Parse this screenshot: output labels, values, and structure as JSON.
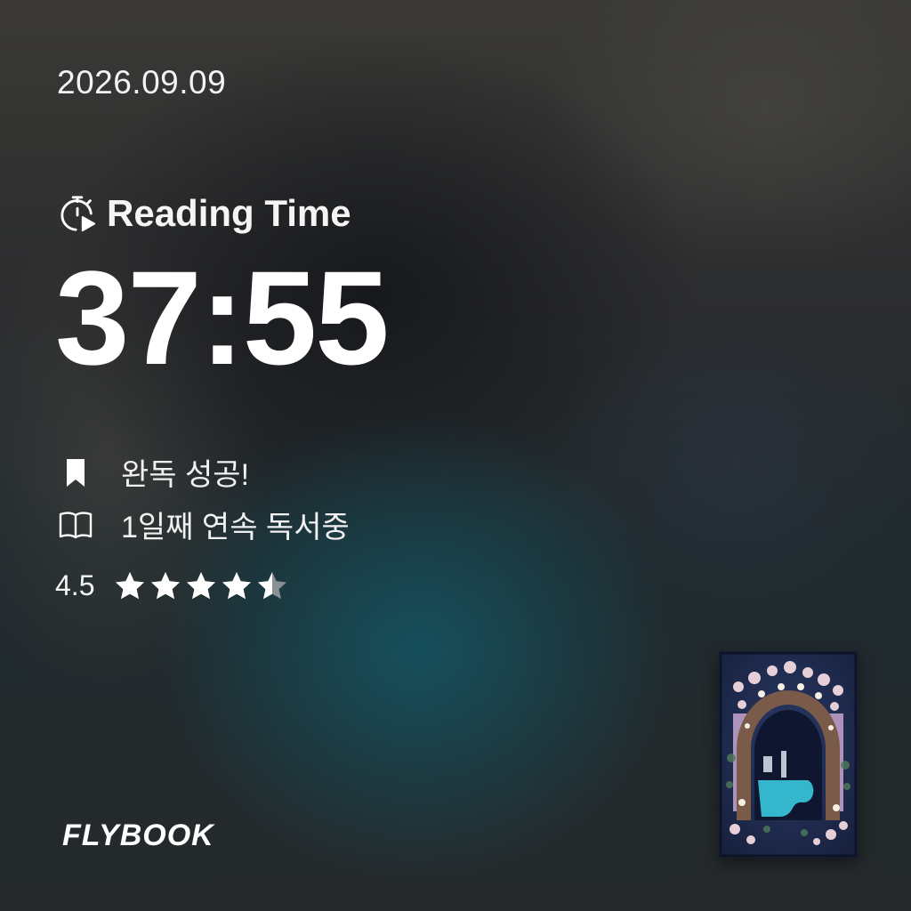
{
  "date": "2026.09.09",
  "reading": {
    "icon": "stopwatch-play-icon",
    "label": "Reading Time",
    "time": "37:55"
  },
  "status": [
    {
      "icon": "bookmark-icon",
      "text": "완독 성공!"
    },
    {
      "icon": "open-book-icon",
      "text": "1일째 연속 독서중"
    }
  ],
  "rating": {
    "value": "4.5",
    "score": 4.5,
    "max": 5,
    "star_color": "#ffffff",
    "empty_color": "#8a8f93"
  },
  "brand": "FLYBOOK",
  "book_cover": {
    "icon": "book-cover-image",
    "palette": [
      "#1f2a4a",
      "#2fb3c9",
      "#c9a6c7",
      "#e8d9c2",
      "#6b4a3a"
    ]
  },
  "colors": {
    "text": "#ffffff",
    "accent_teal": "#125c6c"
  }
}
